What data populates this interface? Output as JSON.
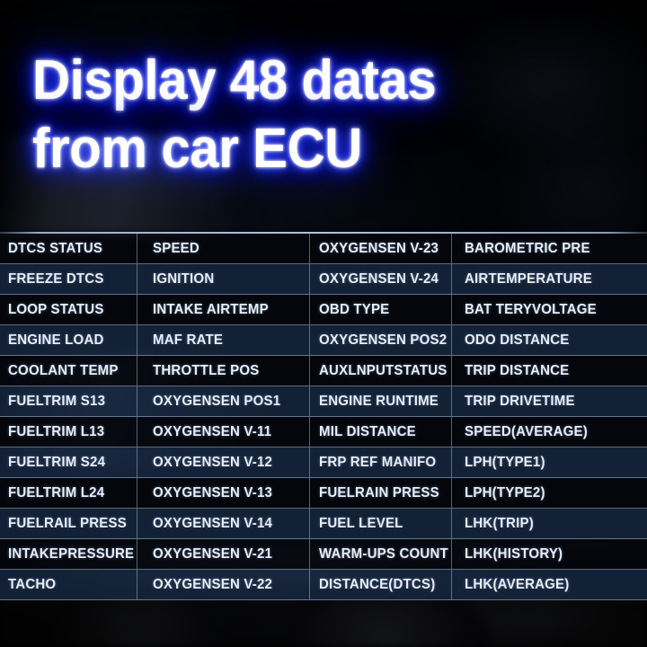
{
  "headline": {
    "line1": "Display 48 datas",
    "line2": "from car ECU",
    "glow_color": "#1a2fff",
    "text_color": "#ffffff"
  },
  "theme": {
    "row_dark": "#04060c",
    "row_blue": "#16263e",
    "grid_line": "#a8bcd8",
    "cell_text": "#e9eef6",
    "background": "#000205"
  },
  "table": {
    "row_count": 12,
    "column_count": 4,
    "total_items": 48,
    "columns": [
      {
        "index": 1,
        "items": [
          "DTCS  STATUS",
          "FREEZE DTCS",
          "LOOP STATUS",
          "ENGINE LOAD",
          "COOLANT TEMP",
          "FUELTRIM S13",
          "FUELTRIM L13",
          "FUELTRIM S24",
          "FUELTRIM L24",
          "FUELRAIL PRESS",
          "INTAKEPRESSURE",
          "TACHO"
        ]
      },
      {
        "index": 2,
        "items": [
          "SPEED",
          "IGNITION",
          "INTAKE AIRTEMP",
          "MAF RATE",
          "THROTTLE POS",
          "OXYGENSEN POS1",
          "OXYGENSEN V-11",
          "OXYGENSEN V-12",
          "OXYGENSEN V-13",
          "OXYGENSEN V-14",
          "OXYGENSEN V-21",
          "OXYGENSEN V-22"
        ]
      },
      {
        "index": 3,
        "items": [
          "OXYGENSEN V-23",
          "OXYGENSEN V-24",
          "OBD TYPE",
          "OXYGENSEN POS2",
          "AUXLNPUTSTATUS",
          "ENGINE RUNTIME",
          "MIL DISTANCE",
          "FRP REF MANIFO",
          "FUELRAIN PRESS",
          "FUEL LEVEL",
          "WARM-UPS COUNT",
          "DISTANCE(DTCS)"
        ]
      },
      {
        "index": 4,
        "items": [
          "BAROMETRIC PRE",
          "AIRTEMPERATURE",
          "BAT TERYVOLTAGE",
          "ODO DISTANCE",
          "TRIP DISTANCE",
          "TRIP DRIVETIME",
          "SPEED(AVERAGE)",
          "LPH(TYPE1)",
          "LPH(TYPE2)",
          "LHK(TRIP)",
          "LHK(HISTORY)",
          "LHK(AVERAGE)"
        ]
      }
    ]
  }
}
